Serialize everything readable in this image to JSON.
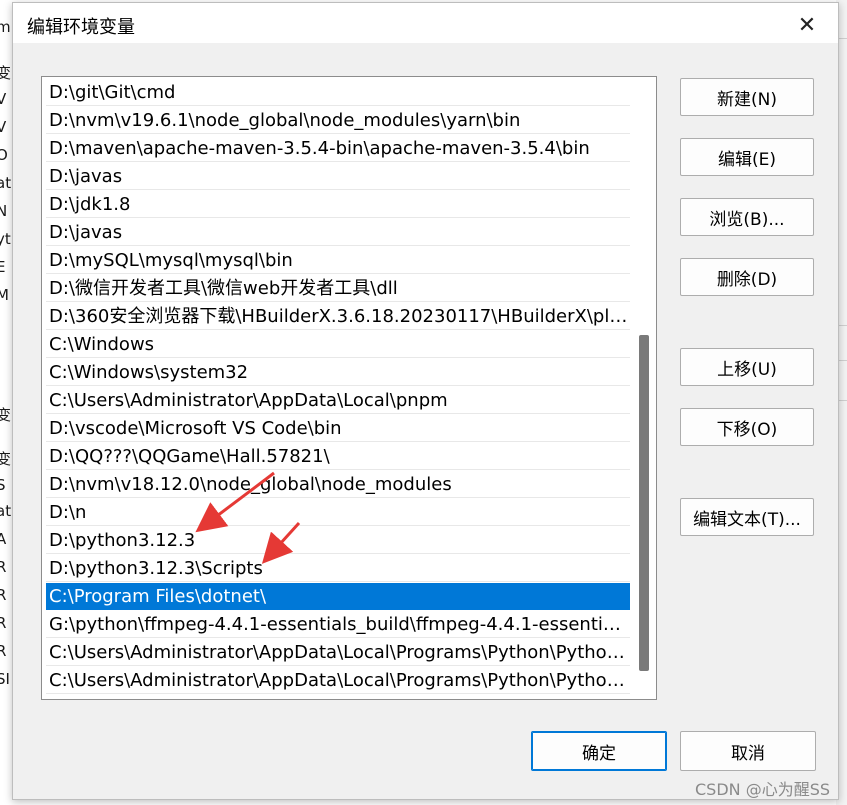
{
  "dialog": {
    "title": "编辑环境变量",
    "close_glyph": "✕"
  },
  "paths": [
    "D:\\git\\Git\\cmd",
    "D:\\nvm\\v19.6.1\\node_global\\node_modules\\yarn\\bin",
    "D:\\maven\\apache-maven-3.5.4-bin\\apache-maven-3.5.4\\bin",
    "D:\\javas",
    "D:\\jdk1.8",
    "D:\\javas",
    "D:\\mySQL\\mysql\\mysql\\bin",
    "D:\\微信开发者工具\\微信web开发者工具\\dll",
    "D:\\360安全浏览器下载\\HBuilderX.3.6.18.20230117\\HBuilderX\\plu...",
    "C:\\Windows",
    "C:\\Windows\\system32",
    "C:\\Users\\Administrator\\AppData\\Local\\pnpm",
    "D:\\vscode\\Microsoft VS Code\\bin",
    "D:\\QQ???\\QQGame\\Hall.57821\\",
    "D:\\nvm\\v18.12.0\\node_global\\node_modules",
    "D:\\n",
    "D:\\python3.12.3",
    "D:\\python3.12.3\\Scripts",
    "C:\\Program Files\\dotnet\\",
    "G:\\python\\ffmpeg-4.4.1-essentials_build\\ffmpeg-4.4.1-essentials_...",
    "C:\\Users\\Administrator\\AppData\\Local\\Programs\\Python\\Python...",
    "C:\\Users\\Administrator\\AppData\\Local\\Programs\\Python\\Python..."
  ],
  "selected_index": 18,
  "buttons": {
    "new": "新建(N)",
    "edit": "编辑(E)",
    "browse": "浏览(B)...",
    "delete": "删除(D)",
    "move_up": "上移(U)",
    "move_down": "下移(O)",
    "edit_text": "编辑文本(T)...",
    "ok": "确定",
    "cancel": "取消"
  },
  "background_left_chars": [
    "m",
    "变",
    "V",
    "V",
    "O",
    "at",
    "N",
    "yt",
    "E",
    "M",
    "变",
    "变",
    "S",
    "at",
    "A",
    "R",
    "R",
    "R",
    "R",
    "SI"
  ],
  "watermark": "CSDN @心为醒SS",
  "colors": {
    "selection": "#0078d7",
    "annotation_arrow": "#e53935"
  }
}
